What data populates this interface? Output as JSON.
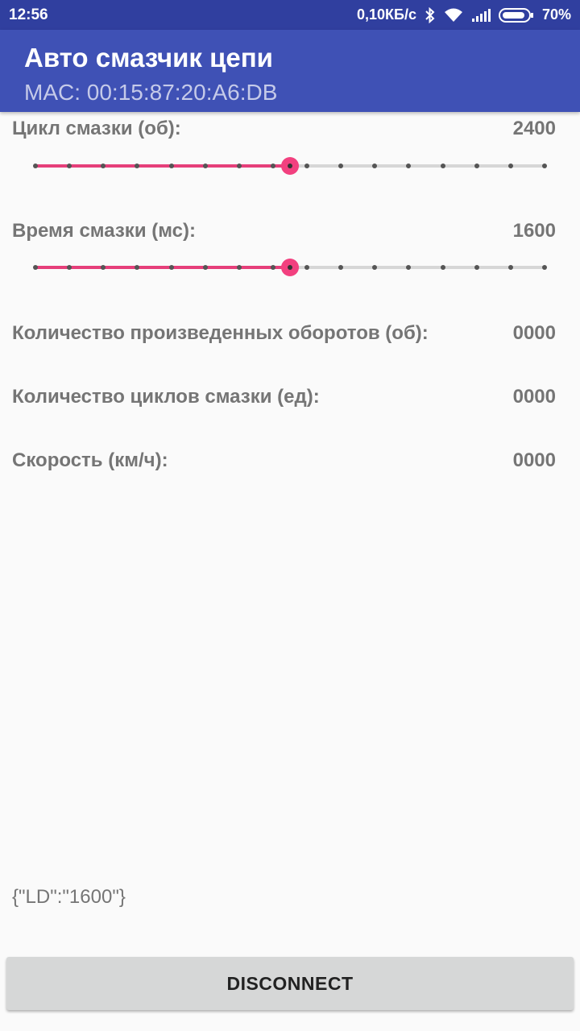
{
  "status_bar": {
    "time": "12:56",
    "network_speed": "0,10КБ/с",
    "battery": "70%",
    "icons": [
      "bluetooth-icon",
      "wifi-icon",
      "signal-icon",
      "battery-icon"
    ]
  },
  "app_bar": {
    "title": "Авто смазчик цепи",
    "subtitle": "MAC: 00:15:87:20:A6:DB"
  },
  "settings": {
    "cycle": {
      "label": "Цикл смазки (об):",
      "value": "2400",
      "slider_progress": 0.5,
      "tick_count": 16
    },
    "duration": {
      "label": "Время смазки (мс):",
      "value": "1600",
      "slider_progress": 0.5,
      "tick_count": 16
    }
  },
  "stats": {
    "revolutions": {
      "label": "Количество произведенных оборотов (об):",
      "value": "0000"
    },
    "cycles": {
      "label": "Количество циклов смазки (ед):",
      "value": "0000"
    },
    "speed": {
      "label": "Скорость (км/ч):",
      "value": "0000"
    }
  },
  "log_text": "{\"LD\":\"1600\"}",
  "disconnect_label": "DISCONNECT",
  "colors": {
    "status_bar": "#303f9f",
    "app_bar": "#3f51b5",
    "accent": "#f2407f",
    "button": "#d6d7d7"
  }
}
